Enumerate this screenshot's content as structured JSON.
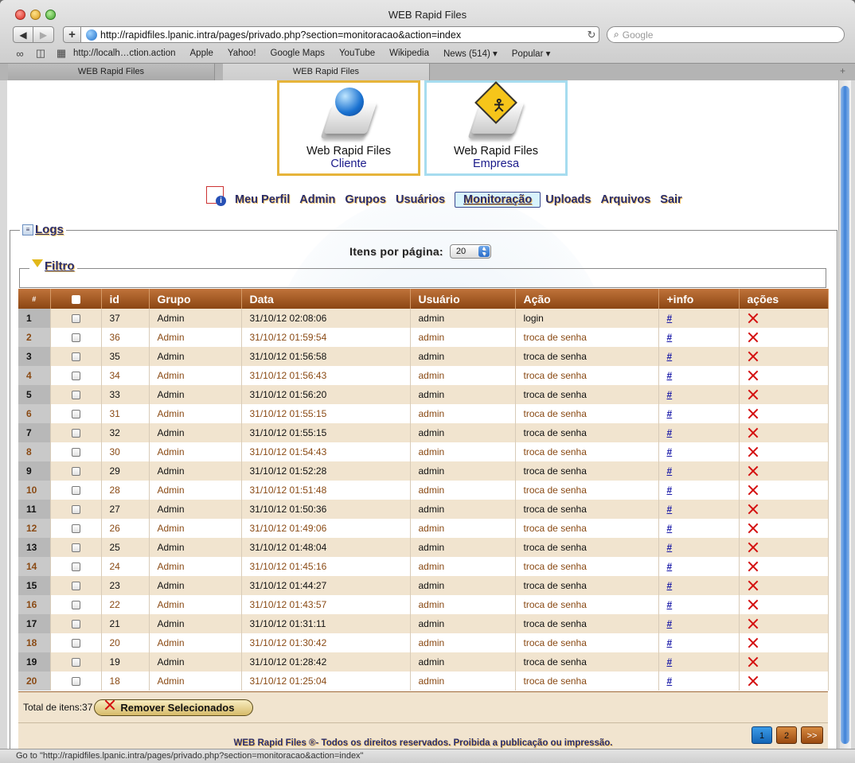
{
  "window": {
    "title": "WEB Rapid Files"
  },
  "toolbar": {
    "url": "http://rapidfiles.lpanic.intra/pages/privado.php?section=monitoracao&action=index",
    "search_placeholder": "Google"
  },
  "bookmarks": [
    "http://localh…ction.action",
    "Apple",
    "Yahoo!",
    "Google Maps",
    "YouTube",
    "Wikipedia",
    "News (514) ▾",
    "Popular ▾"
  ],
  "tabs": [
    {
      "label": "WEB Rapid Files",
      "active": false
    },
    {
      "label": "WEB Rapid Files",
      "active": true
    }
  ],
  "portals": {
    "cliente": {
      "title": "Web Rapid Files",
      "subtitle": "Cliente"
    },
    "empresa": {
      "title": "Web Rapid Files",
      "subtitle": "Empresa"
    }
  },
  "nav": {
    "items": [
      "Meu Perfil",
      "Admin",
      "Grupos",
      "Usuários",
      "Monitoração",
      "Uploads",
      "Arquivos",
      "Sair"
    ],
    "active": "Monitoração"
  },
  "logs": {
    "title": "Logs",
    "per_page_label": "Itens por página:",
    "per_page_value": "20",
    "filter_title": "Filtro"
  },
  "table": {
    "headers": [
      "#",
      "",
      "id",
      "Grupo",
      "Data",
      "Usuário",
      "Ação",
      "+info",
      "ações"
    ],
    "info_link": "#",
    "rows": [
      {
        "n": "1",
        "id": "37",
        "grupo": "Admin",
        "data": "31/10/12 02:08:06",
        "usuario": "admin",
        "acao": "login"
      },
      {
        "n": "2",
        "id": "36",
        "grupo": "Admin",
        "data": "31/10/12 01:59:54",
        "usuario": "admin",
        "acao": "troca de senha"
      },
      {
        "n": "3",
        "id": "35",
        "grupo": "Admin",
        "data": "31/10/12 01:56:58",
        "usuario": "admin",
        "acao": "troca de senha"
      },
      {
        "n": "4",
        "id": "34",
        "grupo": "Admin",
        "data": "31/10/12 01:56:43",
        "usuario": "admin",
        "acao": "troca de senha"
      },
      {
        "n": "5",
        "id": "33",
        "grupo": "Admin",
        "data": "31/10/12 01:56:20",
        "usuario": "admin",
        "acao": "troca de senha"
      },
      {
        "n": "6",
        "id": "31",
        "grupo": "Admin",
        "data": "31/10/12 01:55:15",
        "usuario": "admin",
        "acao": "troca de senha"
      },
      {
        "n": "7",
        "id": "32",
        "grupo": "Admin",
        "data": "31/10/12 01:55:15",
        "usuario": "admin",
        "acao": "troca de senha"
      },
      {
        "n": "8",
        "id": "30",
        "grupo": "Admin",
        "data": "31/10/12 01:54:43",
        "usuario": "admin",
        "acao": "troca de senha"
      },
      {
        "n": "9",
        "id": "29",
        "grupo": "Admin",
        "data": "31/10/12 01:52:28",
        "usuario": "admin",
        "acao": "troca de senha"
      },
      {
        "n": "10",
        "id": "28",
        "grupo": "Admin",
        "data": "31/10/12 01:51:48",
        "usuario": "admin",
        "acao": "troca de senha"
      },
      {
        "n": "11",
        "id": "27",
        "grupo": "Admin",
        "data": "31/10/12 01:50:36",
        "usuario": "admin",
        "acao": "troca de senha"
      },
      {
        "n": "12",
        "id": "26",
        "grupo": "Admin",
        "data": "31/10/12 01:49:06",
        "usuario": "admin",
        "acao": "troca de senha"
      },
      {
        "n": "13",
        "id": "25",
        "grupo": "Admin",
        "data": "31/10/12 01:48:04",
        "usuario": "admin",
        "acao": "troca de senha"
      },
      {
        "n": "14",
        "id": "24",
        "grupo": "Admin",
        "data": "31/10/12 01:45:16",
        "usuario": "admin",
        "acao": "troca de senha"
      },
      {
        "n": "15",
        "id": "23",
        "grupo": "Admin",
        "data": "31/10/12 01:44:27",
        "usuario": "admin",
        "acao": "troca de senha"
      },
      {
        "n": "16",
        "id": "22",
        "grupo": "Admin",
        "data": "31/10/12 01:43:57",
        "usuario": "admin",
        "acao": "troca de senha"
      },
      {
        "n": "17",
        "id": "21",
        "grupo": "Admin",
        "data": "31/10/12 01:31:11",
        "usuario": "admin",
        "acao": "troca de senha"
      },
      {
        "n": "18",
        "id": "20",
        "grupo": "Admin",
        "data": "31/10/12 01:30:42",
        "usuario": "admin",
        "acao": "troca de senha"
      },
      {
        "n": "19",
        "id": "19",
        "grupo": "Admin",
        "data": "31/10/12 01:28:42",
        "usuario": "admin",
        "acao": "troca de senha"
      },
      {
        "n": "20",
        "id": "18",
        "grupo": "Admin",
        "data": "31/10/12 01:25:04",
        "usuario": "admin",
        "acao": "troca de senha"
      }
    ]
  },
  "footer": {
    "total_label": "Total de itens:37",
    "remove_label": "Remover Selecionados",
    "copyright": "WEB Rapid Files ®- Todos os direitos reservados. Proibida a publicação ou impressão.",
    "pages": [
      "1",
      "2"
    ],
    "current_page": "1",
    "next_label": ">>"
  },
  "status_bar": "Go to \"http://rapidfiles.lpanic.intra/pages/privado.php?section=monitoracao&action=index\"",
  "colors": {
    "header_brown": "#8b4613",
    "row_odd": "#f1e4cf",
    "nav_text": "#2a2d6b",
    "delete_red": "#d41010"
  }
}
